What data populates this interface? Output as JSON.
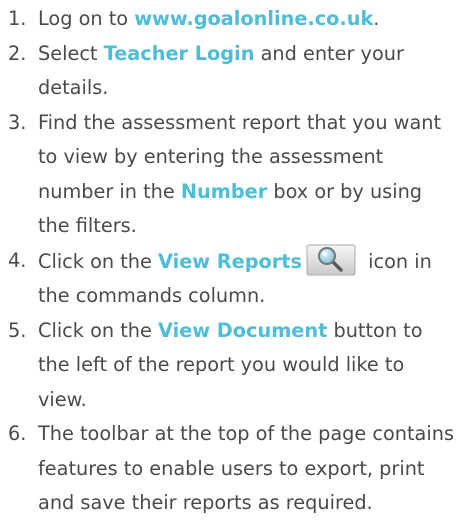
{
  "accent_color": "#4dbdd8",
  "text_color": "#4a4a4a",
  "steps": [
    {
      "num": "1.",
      "t1": "Log on to ",
      "h1": "www.goalonline.co.uk",
      "t2": "."
    },
    {
      "num": "2.",
      "t1": "Select ",
      "h1": "Teacher Login",
      "t2": " and enter your details."
    },
    {
      "num": "3.",
      "t1": "Find the assessment report that you want to view by entering the assessment number in the ",
      "h1": "Number",
      "t2": " box or by using the filters."
    },
    {
      "num": "4.",
      "t1": "Click on the ",
      "h1": "View Reports",
      "icon": "view-reports-magnifier-icon",
      "t2": " icon in the commands column."
    },
    {
      "num": "5.",
      "t1": "Click on the ",
      "h1": "View Document",
      "t2": " button to the left of the report you would like to view."
    },
    {
      "num": "6.",
      "t1": "The toolbar at the top of the page contains features to enable users to export, print and save their reports as required."
    }
  ]
}
